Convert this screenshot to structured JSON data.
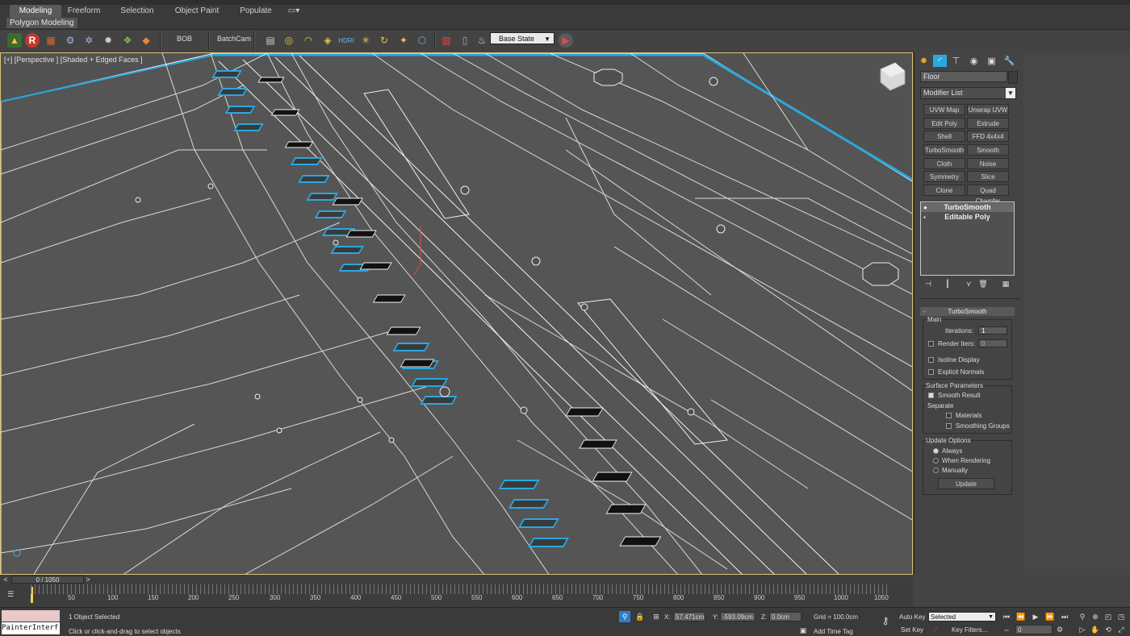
{
  "ribbon": {
    "tabs": [
      "Modeling",
      "Freeform",
      "Selection",
      "Object Paint",
      "Populate"
    ],
    "subtab": "Polygon Modeling"
  },
  "toolbar": {
    "bob_label": "BOB",
    "batchcam_label": "BatchCam",
    "base_state": "Base State"
  },
  "viewport": {
    "label": "[+] [Perspective ] [Shaded + Edged Faces ]"
  },
  "command_panel": {
    "object_name": "Floor",
    "modifier_list": "Modifier List",
    "modifier_buttons": [
      [
        "UVW Map",
        "Unwrap UVW"
      ],
      [
        "Edit Poly",
        "Extrude"
      ],
      [
        "Shell",
        "FFD 4x4x4"
      ],
      [
        "TurboSmooth",
        "Smooth"
      ],
      [
        "Cloth",
        "Noise"
      ],
      [
        "Symmetry",
        "Slice"
      ],
      [
        "Clone",
        "Quad Chamfer"
      ]
    ],
    "stack": [
      "TurboSmooth",
      "Editable Poly"
    ],
    "rollout": {
      "title": "TurboSmooth",
      "main_label": "Main",
      "iterations_label": "Iterations:",
      "iterations_value": "1",
      "render_iters_label": "Render Iters:",
      "render_iters_value": "0",
      "isoline_label": "Isoline Display",
      "explicit_normals_label": "Explicit Normals",
      "surface_params_label": "Surface Parameters",
      "smooth_result_label": "Smooth Result",
      "separate_label": "Separate",
      "materials_label": "Materials",
      "smoothing_groups_label": "Smoothing Groups",
      "update_options_label": "Update Options",
      "always_label": "Always",
      "when_rendering_label": "When Rendering",
      "manually_label": "Manually",
      "update_button": "Update"
    }
  },
  "timeline": {
    "slider": "0 / 1050",
    "ticks": [
      "50",
      "100",
      "150",
      "200",
      "250",
      "300",
      "350",
      "400",
      "450",
      "500",
      "550",
      "600",
      "650",
      "700",
      "750",
      "800",
      "850",
      "900",
      "950",
      "1000",
      "1050"
    ]
  },
  "status": {
    "maxscript": "PainterInterf",
    "selection_info": "1 Object Selected",
    "prompt": "Click or click-and-drag to select objects",
    "x_label": "X:",
    "x_value": "57.471cm",
    "y_label": "Y:",
    "y_value": "-593.09cm",
    "z_label": "Z:",
    "z_value": "0.0cm",
    "grid": "Grid = 100.0cm",
    "add_time_tag": "Add Time Tag",
    "auto_key": "Auto Key",
    "set_key": "Set Key",
    "selected": "Selected",
    "key_filters": "Key Filters...",
    "frame": "0"
  },
  "colors": {
    "accent_blue": "#2aa8e0",
    "viewport_bg": "#525252",
    "viewport_border": "#d8c27a"
  }
}
